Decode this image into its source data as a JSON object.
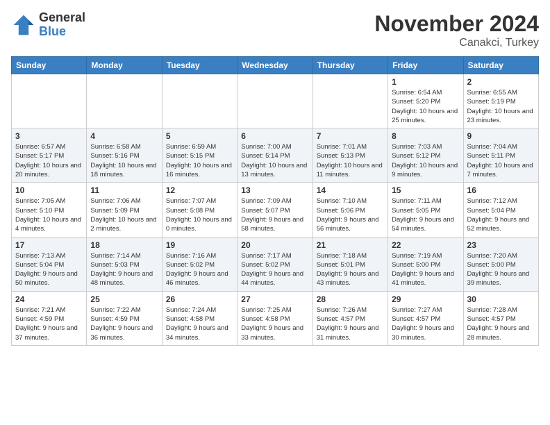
{
  "header": {
    "logo": {
      "general": "General",
      "blue": "Blue"
    },
    "title": "November 2024",
    "location": "Canakci, Turkey"
  },
  "days_of_week": [
    "Sunday",
    "Monday",
    "Tuesday",
    "Wednesday",
    "Thursday",
    "Friday",
    "Saturday"
  ],
  "weeks": [
    [
      {
        "day": "",
        "info": ""
      },
      {
        "day": "",
        "info": ""
      },
      {
        "day": "",
        "info": ""
      },
      {
        "day": "",
        "info": ""
      },
      {
        "day": "",
        "info": ""
      },
      {
        "day": "1",
        "info": "Sunrise: 6:54 AM\nSunset: 5:20 PM\nDaylight: 10 hours and 25 minutes."
      },
      {
        "day": "2",
        "info": "Sunrise: 6:55 AM\nSunset: 5:19 PM\nDaylight: 10 hours and 23 minutes."
      }
    ],
    [
      {
        "day": "3",
        "info": "Sunrise: 6:57 AM\nSunset: 5:17 PM\nDaylight: 10 hours and 20 minutes."
      },
      {
        "day": "4",
        "info": "Sunrise: 6:58 AM\nSunset: 5:16 PM\nDaylight: 10 hours and 18 minutes."
      },
      {
        "day": "5",
        "info": "Sunrise: 6:59 AM\nSunset: 5:15 PM\nDaylight: 10 hours and 16 minutes."
      },
      {
        "day": "6",
        "info": "Sunrise: 7:00 AM\nSunset: 5:14 PM\nDaylight: 10 hours and 13 minutes."
      },
      {
        "day": "7",
        "info": "Sunrise: 7:01 AM\nSunset: 5:13 PM\nDaylight: 10 hours and 11 minutes."
      },
      {
        "day": "8",
        "info": "Sunrise: 7:03 AM\nSunset: 5:12 PM\nDaylight: 10 hours and 9 minutes."
      },
      {
        "day": "9",
        "info": "Sunrise: 7:04 AM\nSunset: 5:11 PM\nDaylight: 10 hours and 7 minutes."
      }
    ],
    [
      {
        "day": "10",
        "info": "Sunrise: 7:05 AM\nSunset: 5:10 PM\nDaylight: 10 hours and 4 minutes."
      },
      {
        "day": "11",
        "info": "Sunrise: 7:06 AM\nSunset: 5:09 PM\nDaylight: 10 hours and 2 minutes."
      },
      {
        "day": "12",
        "info": "Sunrise: 7:07 AM\nSunset: 5:08 PM\nDaylight: 10 hours and 0 minutes."
      },
      {
        "day": "13",
        "info": "Sunrise: 7:09 AM\nSunset: 5:07 PM\nDaylight: 9 hours and 58 minutes."
      },
      {
        "day": "14",
        "info": "Sunrise: 7:10 AM\nSunset: 5:06 PM\nDaylight: 9 hours and 56 minutes."
      },
      {
        "day": "15",
        "info": "Sunrise: 7:11 AM\nSunset: 5:05 PM\nDaylight: 9 hours and 54 minutes."
      },
      {
        "day": "16",
        "info": "Sunrise: 7:12 AM\nSunset: 5:04 PM\nDaylight: 9 hours and 52 minutes."
      }
    ],
    [
      {
        "day": "17",
        "info": "Sunrise: 7:13 AM\nSunset: 5:04 PM\nDaylight: 9 hours and 50 minutes."
      },
      {
        "day": "18",
        "info": "Sunrise: 7:14 AM\nSunset: 5:03 PM\nDaylight: 9 hours and 48 minutes."
      },
      {
        "day": "19",
        "info": "Sunrise: 7:16 AM\nSunset: 5:02 PM\nDaylight: 9 hours and 46 minutes."
      },
      {
        "day": "20",
        "info": "Sunrise: 7:17 AM\nSunset: 5:02 PM\nDaylight: 9 hours and 44 minutes."
      },
      {
        "day": "21",
        "info": "Sunrise: 7:18 AM\nSunset: 5:01 PM\nDaylight: 9 hours and 43 minutes."
      },
      {
        "day": "22",
        "info": "Sunrise: 7:19 AM\nSunset: 5:00 PM\nDaylight: 9 hours and 41 minutes."
      },
      {
        "day": "23",
        "info": "Sunrise: 7:20 AM\nSunset: 5:00 PM\nDaylight: 9 hours and 39 minutes."
      }
    ],
    [
      {
        "day": "24",
        "info": "Sunrise: 7:21 AM\nSunset: 4:59 PM\nDaylight: 9 hours and 37 minutes."
      },
      {
        "day": "25",
        "info": "Sunrise: 7:22 AM\nSunset: 4:59 PM\nDaylight: 9 hours and 36 minutes."
      },
      {
        "day": "26",
        "info": "Sunrise: 7:24 AM\nSunset: 4:58 PM\nDaylight: 9 hours and 34 minutes."
      },
      {
        "day": "27",
        "info": "Sunrise: 7:25 AM\nSunset: 4:58 PM\nDaylight: 9 hours and 33 minutes."
      },
      {
        "day": "28",
        "info": "Sunrise: 7:26 AM\nSunset: 4:57 PM\nDaylight: 9 hours and 31 minutes."
      },
      {
        "day": "29",
        "info": "Sunrise: 7:27 AM\nSunset: 4:57 PM\nDaylight: 9 hours and 30 minutes."
      },
      {
        "day": "30",
        "info": "Sunrise: 7:28 AM\nSunset: 4:57 PM\nDaylight: 9 hours and 28 minutes."
      }
    ]
  ]
}
